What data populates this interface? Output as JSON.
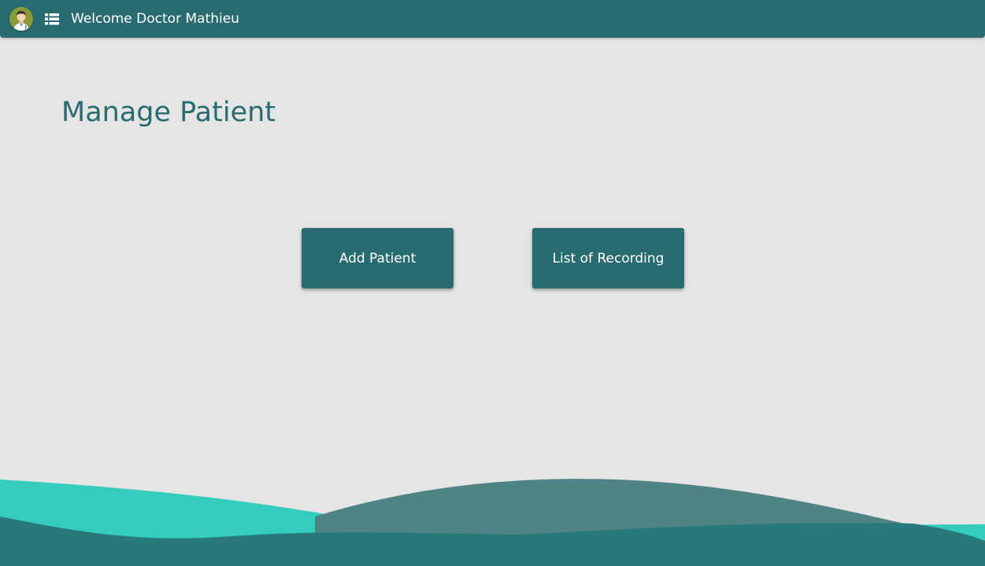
{
  "header": {
    "welcome_text": "Welcome Doctor Mathieu",
    "avatar_icon": "doctor-avatar-icon",
    "menu_icon": "list-menu-icon"
  },
  "main": {
    "title": "Manage Patient",
    "buttons": {
      "add_patient": "Add Patient",
      "list_of_recording": "List of Recording"
    }
  },
  "colors": {
    "primary": "#286b70",
    "background": "#e5e5e6",
    "wave_light": "#33ccbd",
    "wave_mid": "#508385",
    "wave_dark": "#287a7a"
  }
}
